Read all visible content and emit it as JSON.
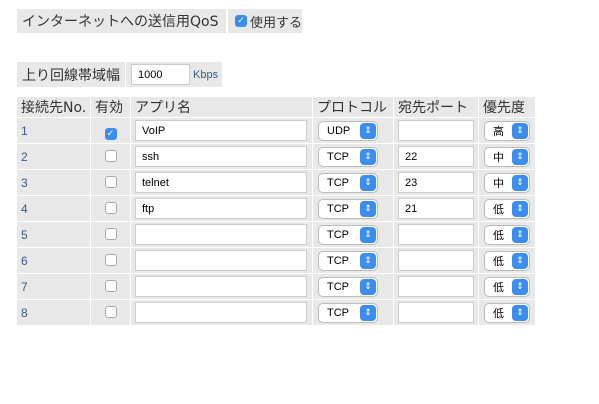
{
  "qos": {
    "label": "インターネットへの送信用QoS",
    "enable_label": "使用する",
    "enabled": true
  },
  "bandwidth": {
    "label": "上り回線帯域幅",
    "value": "1000",
    "unit": "Kbps"
  },
  "table": {
    "headers": [
      "接続先No.",
      "有効",
      "アプリ名",
      "プロトコル",
      "宛先ポート",
      "優先度"
    ],
    "rows": [
      {
        "no": "1",
        "enabled": true,
        "app": "VoIP",
        "protocol": "UDP",
        "port": "",
        "priority": "高"
      },
      {
        "no": "2",
        "enabled": false,
        "app": "ssh",
        "protocol": "TCP",
        "port": "22",
        "priority": "中"
      },
      {
        "no": "3",
        "enabled": false,
        "app": "telnet",
        "protocol": "TCP",
        "port": "23",
        "priority": "中"
      },
      {
        "no": "4",
        "enabled": false,
        "app": "ftp",
        "protocol": "TCP",
        "port": "21",
        "priority": "低"
      },
      {
        "no": "5",
        "enabled": false,
        "app": "",
        "protocol": "TCP",
        "port": "",
        "priority": "低"
      },
      {
        "no": "6",
        "enabled": false,
        "app": "",
        "protocol": "TCP",
        "port": "",
        "priority": "低"
      },
      {
        "no": "7",
        "enabled": false,
        "app": "",
        "protocol": "TCP",
        "port": "",
        "priority": "低"
      },
      {
        "no": "8",
        "enabled": false,
        "app": "",
        "protocol": "TCP",
        "port": "",
        "priority": "低"
      }
    ]
  },
  "colors": {
    "accent": "#3b8ef0",
    "cell_bg": "#e8e8e8",
    "unit_text": "#3a5a8a"
  }
}
